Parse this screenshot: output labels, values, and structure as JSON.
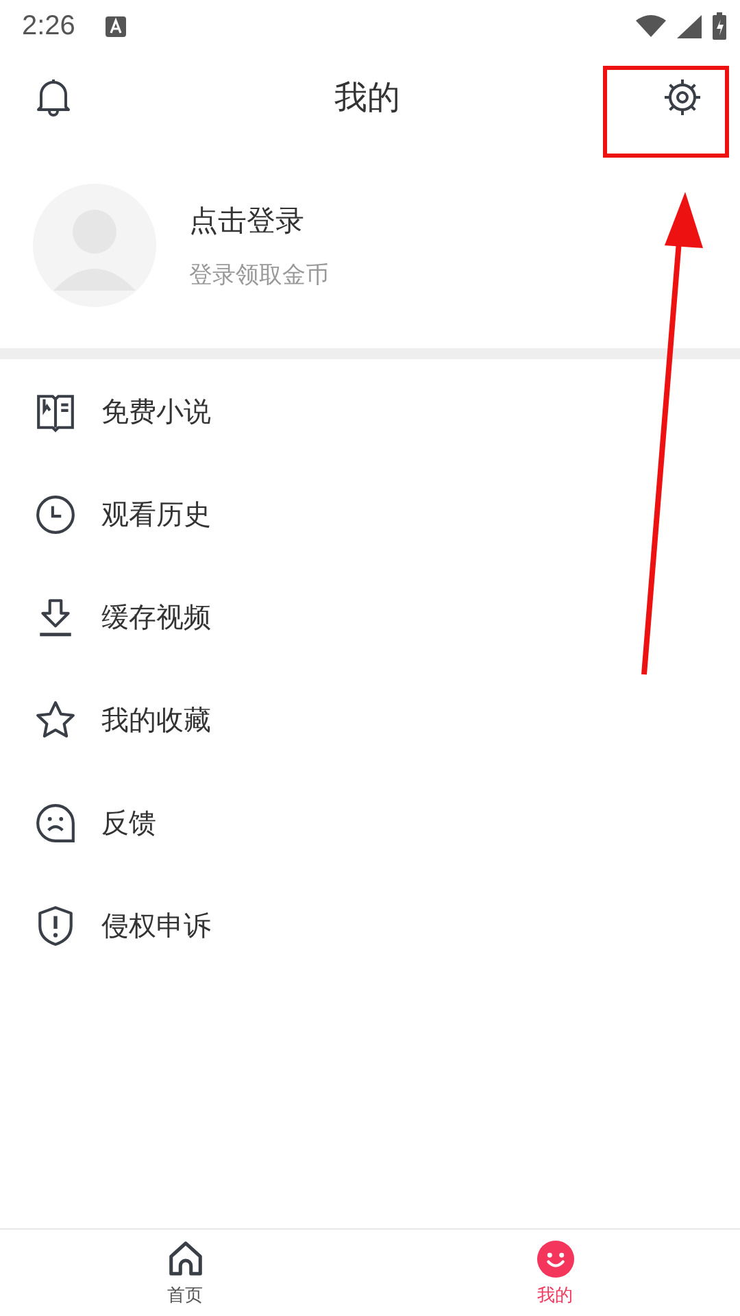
{
  "status_bar": {
    "time": "2:26"
  },
  "header": {
    "title": "我的"
  },
  "profile": {
    "name": "点击登录",
    "subtitle": "登录领取金币"
  },
  "menu": [
    {
      "kind": "book",
      "label": "免费小说"
    },
    {
      "kind": "clock",
      "label": "观看历史"
    },
    {
      "kind": "download",
      "label": "缓存视频"
    },
    {
      "kind": "star",
      "label": "我的收藏"
    },
    {
      "kind": "feedback",
      "label": "反馈"
    },
    {
      "kind": "shield",
      "label": "侵权申诉"
    }
  ],
  "bottom_nav": [
    {
      "kind": "home",
      "label": "首页",
      "selected": false
    },
    {
      "kind": "me",
      "label": "我的",
      "selected": true
    }
  ]
}
